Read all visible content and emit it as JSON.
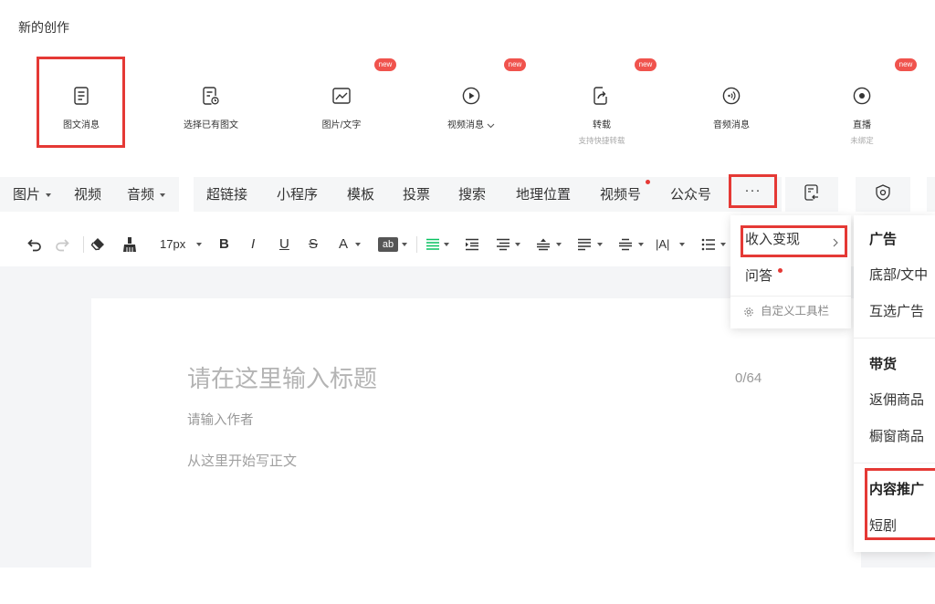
{
  "header": {
    "title": "新的创作"
  },
  "create_types": [
    {
      "label": "图文消息",
      "icon": "article-icon"
    },
    {
      "label": "选择已有图文",
      "icon": "history-article-icon"
    },
    {
      "label": "图片/文字",
      "icon": "image-text-icon",
      "badge": "new"
    },
    {
      "label": "视频消息",
      "icon": "video-play-icon",
      "badge": "new"
    },
    {
      "label": "转载",
      "sub": "支持快捷转载",
      "icon": "repost-icon",
      "badge": "new"
    },
    {
      "label": "音频消息",
      "icon": "audio-icon"
    },
    {
      "label": "直播",
      "sub": "未绑定",
      "icon": "live-icon",
      "badge": "new"
    }
  ],
  "media_toolbar": {
    "image": "图片",
    "video": "视频",
    "audio": "音频",
    "items": [
      "超链接",
      "小程序",
      "模板",
      "投票",
      "搜索",
      "地理位置",
      "视频号",
      "公众号"
    ],
    "more": "···",
    "icon_buttons": [
      "import-doc-icon",
      "shield-icon"
    ]
  },
  "format_toolbar": {
    "font_size": "17px",
    "bold": "B",
    "italic": "I",
    "underline": "U",
    "strikethrough": "S",
    "font_color": "A",
    "highlight": "ab",
    "letter_spacing": "|A|",
    "icons": [
      "undo-icon",
      "redo-icon",
      "eraser-icon",
      "format-brush-icon",
      "align-left-icon",
      "indent-icon",
      "line-height-icon",
      "align-center-icon",
      "justify-icon",
      "paragraph-spacing-icon",
      "list-icon"
    ]
  },
  "more_menu": {
    "items": [
      {
        "label": "收入变现",
        "has_submenu": true
      },
      {
        "label": "问答",
        "dot": true
      }
    ],
    "customize": "自定义工具栏"
  },
  "monetize_submenu": {
    "groups": [
      {
        "title": "广告",
        "items": [
          "底部/文中",
          "互选广告"
        ]
      },
      {
        "title": "带货",
        "items": [
          "返佣商品",
          "橱窗商品"
        ]
      },
      {
        "title": "内容推广",
        "items": [
          "短剧"
        ]
      }
    ]
  },
  "editor": {
    "title_placeholder": "请在这里输入标题",
    "title_counter": "0/64",
    "author_placeholder": "请输入作者",
    "body_placeholder": "从这里开始写正文"
  },
  "colors": {
    "accent": "#07c160",
    "highlight_border": "#e53935",
    "badge": "#f0534d",
    "notice_dot": "#e53935",
    "editor_background": "#f4f5f7"
  }
}
